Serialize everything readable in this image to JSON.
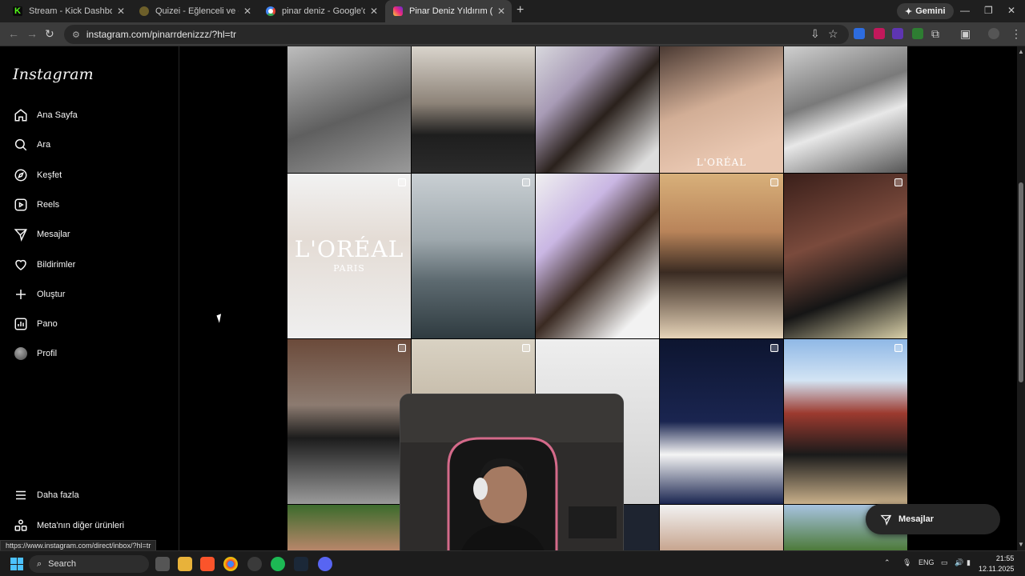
{
  "browser": {
    "tabs": [
      {
        "title": "Stream - Kick Dashboard",
        "favicon": "kick-favicon"
      },
      {
        "title": "Quizei - Eğlenceli ve etkileşimli",
        "favicon": "quizei-favicon"
      },
      {
        "title": "pinar deniz - Google'da Ara",
        "favicon": "google-favicon"
      },
      {
        "title": "Pinar Deniz Yıldırım (@pinarrde",
        "favicon": "instagram-favicon"
      }
    ],
    "gemini_label": "Gemini",
    "url": "instagram.com/pinarrdenizzz/?hl=tr"
  },
  "instagram": {
    "logo": "Instagram",
    "nav": [
      {
        "label": "Ana Sayfa",
        "icon": "home-icon"
      },
      {
        "label": "Ara",
        "icon": "search-icon"
      },
      {
        "label": "Keşfet",
        "icon": "compass-icon"
      },
      {
        "label": "Reels",
        "icon": "reels-icon"
      },
      {
        "label": "Mesajlar",
        "icon": "messenger-icon"
      },
      {
        "label": "Bildirimler",
        "icon": "heart-icon"
      },
      {
        "label": "Oluştur",
        "icon": "plus-icon"
      },
      {
        "label": "Pano",
        "icon": "dashboard-icon"
      },
      {
        "label": "Profil",
        "icon": "avatar"
      }
    ],
    "bottom_nav": [
      {
        "label": "Daha fazla",
        "icon": "menu-icon"
      },
      {
        "label": "Meta'nın diğer ürünleri",
        "icon": "meta-products-icon"
      }
    ],
    "posts": {
      "loreal_small": "L'ORÉAL",
      "loreal_big": "L'ORÉAL",
      "loreal_paris": "PARIS"
    },
    "messages_pill": "Mesajlar",
    "status_url": "https://www.instagram.com/direct/inbox/?hl=tr"
  },
  "taskbar": {
    "search_placeholder": "Search",
    "lang": "ENG",
    "time": "21:55",
    "date": "12.11.2025"
  }
}
